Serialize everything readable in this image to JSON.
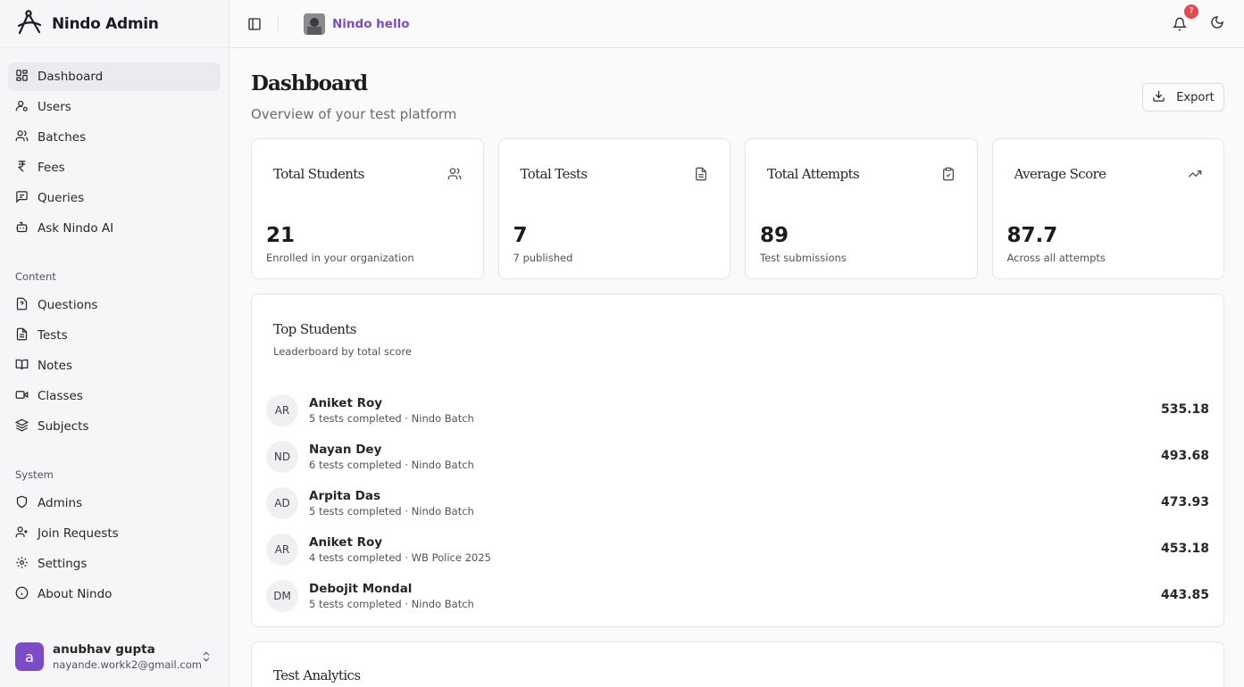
{
  "brand": {
    "name": "Nindo Admin"
  },
  "sidebar": {
    "main_items": [
      {
        "label": "Dashboard",
        "icon": "dashboard-icon",
        "active": true
      },
      {
        "label": "Users",
        "icon": "users-icon"
      },
      {
        "label": "Batches",
        "icon": "batches-icon"
      },
      {
        "label": "Fees",
        "icon": "rupee-icon"
      },
      {
        "label": "Queries",
        "icon": "message-icon"
      },
      {
        "label": "Ask Nindo AI",
        "icon": "bot-icon"
      }
    ],
    "content_section": "Content",
    "content_items": [
      {
        "label": "Questions",
        "icon": "question-file-icon"
      },
      {
        "label": "Tests",
        "icon": "file-text-icon"
      },
      {
        "label": "Notes",
        "icon": "book-open-icon"
      },
      {
        "label": "Classes",
        "icon": "video-icon"
      },
      {
        "label": "Subjects",
        "icon": "layers-icon"
      }
    ],
    "system_section": "System",
    "system_items": [
      {
        "label": "Admins",
        "icon": "shield-icon"
      },
      {
        "label": "Join Requests",
        "icon": "user-plus-icon"
      },
      {
        "label": "Settings",
        "icon": "gear-icon"
      },
      {
        "label": "About Nindo",
        "icon": "info-icon"
      }
    ],
    "user": {
      "initial": "a",
      "name": "anubhav gupta",
      "email": "nayande.workk2@gmail.com"
    }
  },
  "topbar": {
    "org_name": "Nindo hello",
    "notification_count": "7"
  },
  "page": {
    "title": "Dashboard",
    "subtitle": "Overview of your test platform",
    "export_label": "Export"
  },
  "stats": [
    {
      "label": "Total Students",
      "value": "21",
      "desc": "Enrolled in your organization",
      "icon": "users-icon"
    },
    {
      "label": "Total Tests",
      "value": "7",
      "desc": "7 published",
      "icon": "file-text-icon"
    },
    {
      "label": "Total Attempts",
      "value": "89",
      "desc": "Test submissions",
      "icon": "clipboard-check-icon"
    },
    {
      "label": "Average Score",
      "value": "87.7",
      "desc": "Across all attempts",
      "icon": "trending-up-icon"
    }
  ],
  "top_students": {
    "title": "Top Students",
    "subtitle": "Leaderboard by total score",
    "rows": [
      {
        "initials": "AR",
        "name": "Aniket Roy",
        "meta": "5 tests completed · Nindo Batch",
        "score": "535.18"
      },
      {
        "initials": "ND",
        "name": "Nayan Dey",
        "meta": "6 tests completed · Nindo Batch",
        "score": "493.68"
      },
      {
        "initials": "AD",
        "name": "Arpita Das",
        "meta": "5 tests completed · Nindo Batch",
        "score": "473.93"
      },
      {
        "initials": "AR",
        "name": "Aniket Roy",
        "meta": "4 tests completed · WB Police 2025",
        "score": "453.18"
      },
      {
        "initials": "DM",
        "name": "Debojit Mondal",
        "meta": "5 tests completed · Nindo Batch",
        "score": "443.85"
      }
    ]
  },
  "test_analytics": {
    "title": "Test Analytics"
  },
  "colors": {
    "accent": "#7c4bc7",
    "badge": "#e5484d"
  }
}
